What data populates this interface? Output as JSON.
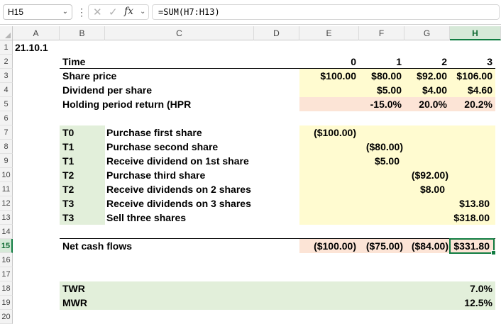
{
  "formula_bar": {
    "name_box": "H15",
    "formula": "=SUM(H7:H13)"
  },
  "columns": [
    "A",
    "B",
    "C",
    "D",
    "E",
    "F",
    "G",
    "H"
  ],
  "rows": [
    "1",
    "2",
    "3",
    "4",
    "5",
    "6",
    "7",
    "8",
    "9",
    "10",
    "11",
    "12",
    "13",
    "14",
    "15",
    "16",
    "17",
    "18",
    "19",
    "20"
  ],
  "colors": {
    "yellow_fill": "#fffbd0",
    "peach_fill": "#fce4d6",
    "green_fill": "#e2efda",
    "selection_green": "#107c41"
  },
  "sheet": {
    "a1": "21.10.1",
    "time_row": {
      "label": "Time",
      "t0": "0",
      "t1": "1",
      "t2": "2",
      "t3": "3"
    },
    "share_price": {
      "label": "Share price",
      "t0": "$100.00",
      "t1": "$80.00",
      "t2": "$92.00",
      "t3": "$106.00"
    },
    "dividend": {
      "label": "Dividend per share",
      "t1": "$5.00",
      "t2": "$4.00",
      "t3": "$4.60"
    },
    "hpr": {
      "label": "Holding period return (HPR",
      "t1": "-15.0%",
      "t2": "20.0%",
      "t3": "20.2%"
    },
    "flows": [
      {
        "period": "T0",
        "desc": "Purchase first share",
        "e": "($100.00)",
        "f": "",
        "g": "",
        "h": ""
      },
      {
        "period": "T1",
        "desc": "Purchase second share",
        "e": "",
        "f": "($80.00)",
        "g": "",
        "h": ""
      },
      {
        "period": "T1",
        "desc": "Receive dividend on 1st share",
        "e": "",
        "f": "$5.00",
        "g": "",
        "h": ""
      },
      {
        "period": "T2",
        "desc": "Purchase third share",
        "e": "",
        "f": "",
        "g": "($92.00)",
        "h": ""
      },
      {
        "period": "T2",
        "desc": "Receive dividends on 2 shares",
        "e": "",
        "f": "",
        "g": "$8.00",
        "h": ""
      },
      {
        "period": "T3",
        "desc": "Receive dividends on 3 shares",
        "e": "",
        "f": "",
        "g": "",
        "h": "$13.80"
      },
      {
        "period": "T3",
        "desc": "Sell three shares",
        "e": "",
        "f": "",
        "g": "",
        "h": "$318.00"
      }
    ],
    "net_cash_flows": {
      "label": "Net cash flows",
      "e": "($100.00)",
      "f": "($75.00)",
      "g": "($84.00)",
      "h": "$331.80"
    },
    "twr": {
      "label": "TWR",
      "value": "7.0%"
    },
    "mwr": {
      "label": "MWR",
      "value": "12.5%"
    }
  }
}
